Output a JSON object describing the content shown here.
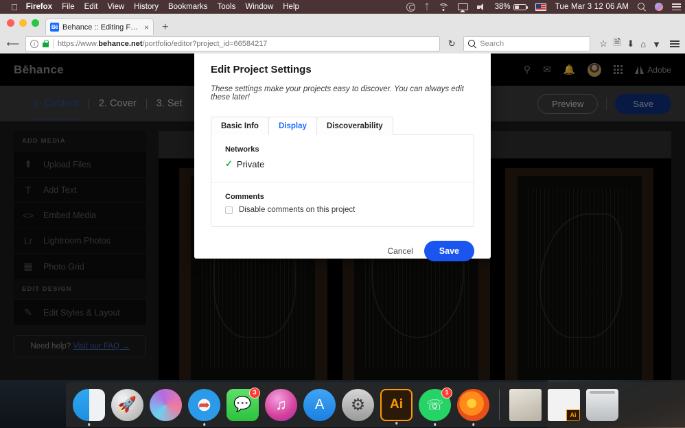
{
  "menubar": {
    "apple_icon": "apple-icon",
    "items": [
      {
        "label": "Firefox",
        "bold": true
      },
      {
        "label": "File",
        "bold": false
      },
      {
        "label": "Edit",
        "bold": false
      },
      {
        "label": "View",
        "bold": false
      },
      {
        "label": "History",
        "bold": false
      },
      {
        "label": "Bookmarks",
        "bold": false
      },
      {
        "label": "Tools",
        "bold": false
      },
      {
        "label": "Window",
        "bold": false
      },
      {
        "label": "Help",
        "bold": false
      }
    ],
    "status": {
      "creative_cloud_icon": "creative-cloud-icon",
      "bluetooth_icon": "bluetooth-icon",
      "wifi_icon": "wifi-icon",
      "airplay_icon": "airplay-icon",
      "volume_icon": "volume-icon",
      "battery_percent": "38%",
      "input_source": "us-flag-icon",
      "clock": "Tue Mar 3  12 06 AM",
      "spotlight_icon": "search-icon",
      "siri_icon": "siri-icon",
      "notification_center_icon": "list-icon"
    },
    "bg_color": "#4a3334"
  },
  "browser": {
    "tab": {
      "favicon_text": "Bē",
      "title": "Behance :: Editing Fairytale...",
      "close_label": "×"
    },
    "new_tab_label": "+",
    "nav": {
      "back_label": "←",
      "info_label": "i",
      "url": {
        "scheme": "https://www.",
        "domain": "behance.net",
        "path": "/portfolio/editor?project_id=66584217"
      },
      "reload_label": "↻",
      "search_placeholder": "Search",
      "icons": [
        "star-icon",
        "reader-icon",
        "download-icon",
        "home-icon",
        "pocket-icon",
        "hamburger-menu-icon"
      ]
    }
  },
  "behance": {
    "logo": "Bēhance",
    "header_icons": [
      "search-icon",
      "mail-icon",
      "bell-icon",
      "avatar",
      "app-grid-icon"
    ],
    "adobe_label": "Adobe",
    "steps": [
      {
        "label": "1. Content",
        "active": true
      },
      {
        "label": "2. Cover",
        "active": false
      },
      {
        "label": "3. Set",
        "active": false
      }
    ],
    "preview_label": "Preview",
    "save_label": "Save",
    "sidebar": {
      "add_media_heading": "ADD MEDIA",
      "add_media_items": [
        {
          "label": "Upload Files",
          "icon": "upload-icon"
        },
        {
          "label": "Add Text",
          "icon": "text-icon"
        },
        {
          "label": "Embed Media",
          "icon": "embed-code-icon"
        },
        {
          "label": "Lightroom Photos",
          "icon": "lightroom-icon"
        },
        {
          "label": "Photo Grid",
          "icon": "grid-icon"
        }
      ],
      "edit_design_heading": "EDIT DESIGN",
      "edit_design_items": [
        {
          "label": "Edit Styles & Layout",
          "icon": "pencil-icon"
        }
      ],
      "faq_text": "Need help? ",
      "faq_link": "Visit our FAQ →"
    },
    "gallery": [
      {
        "name": "linocut-wolf-plate"
      },
      {
        "name": "linocut-bear-plate"
      },
      {
        "name": "linocut-raven-plate"
      }
    ]
  },
  "modal": {
    "title": "Edit Project Settings",
    "subtitle": "These settings make your projects easy to discover. You can always edit these later!",
    "tabs": [
      {
        "label": "Basic Info",
        "active": false
      },
      {
        "label": "Display",
        "active": true
      },
      {
        "label": "Discoverability",
        "active": false
      }
    ],
    "networks": {
      "label": "Networks",
      "check_glyph": "✓",
      "value": "Private",
      "check_color": "#1db438"
    },
    "comments": {
      "label": "Comments",
      "checkbox_label": "Disable comments on this project",
      "checked": false
    },
    "cancel_label": "Cancel",
    "save_label": "Save",
    "accent_color": "#1b55f0"
  },
  "dock": {
    "items": [
      {
        "name": "finder",
        "label": "Finder",
        "running": true,
        "badge": ""
      },
      {
        "name": "launchpad",
        "label": "Launchpad",
        "running": false,
        "badge": ""
      },
      {
        "name": "siri",
        "label": "Siri",
        "running": false,
        "badge": ""
      },
      {
        "name": "safari",
        "label": "Safari",
        "running": true,
        "badge": ""
      },
      {
        "name": "messages",
        "label": "Messages",
        "running": false,
        "badge": "3"
      },
      {
        "name": "itunes",
        "label": "iTunes",
        "running": false,
        "badge": ""
      },
      {
        "name": "appstore",
        "label": "App Store",
        "running": false,
        "badge": ""
      },
      {
        "name": "sysprefs",
        "label": "System Preferences",
        "running": false,
        "badge": ""
      },
      {
        "name": "illustrator",
        "label": "Ai",
        "running": true,
        "badge": ""
      },
      {
        "name": "whatsapp",
        "label": "WhatsApp",
        "running": true,
        "badge": "1"
      },
      {
        "name": "firefox",
        "label": "Firefox",
        "running": true,
        "badge": ""
      },
      {
        "name": "docstack",
        "label": "Documents",
        "running": false,
        "badge": ""
      },
      {
        "name": "aifile",
        "label": "Ai",
        "running": false,
        "badge": ""
      },
      {
        "name": "trash",
        "label": "Trash",
        "running": false,
        "badge": ""
      }
    ]
  }
}
